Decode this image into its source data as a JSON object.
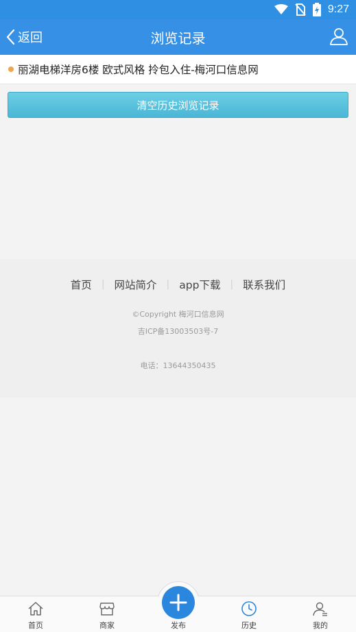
{
  "status_bar": {
    "time": "9:27"
  },
  "header": {
    "back_label": "返回",
    "title": "浏览记录"
  },
  "history": [
    {
      "title": "丽湖电梯洋房6楼 欧式风格 拎包入住-梅河口信息网"
    }
  ],
  "clear_button_label": "清空历史浏览记录",
  "footer": {
    "links": [
      "首页",
      "网站简介",
      "app下载",
      "联系我们"
    ],
    "copyright": "©Copyright  梅河口信息网",
    "icp": "吉ICP备13003503号-7",
    "phone": "电话：13644350435"
  },
  "tabbar": {
    "tabs": [
      {
        "label": "首页",
        "icon": "home-icon"
      },
      {
        "label": "商家",
        "icon": "store-icon"
      },
      {
        "label": "发布",
        "icon": "plus-icon"
      },
      {
        "label": "历史",
        "icon": "clock-icon"
      },
      {
        "label": "我的",
        "icon": "user-icon"
      }
    ]
  },
  "colors": {
    "header": "#3590e6",
    "accent": "#2b86de",
    "clear_button": "#4bb6d6",
    "bullet": "#f0a64a"
  }
}
